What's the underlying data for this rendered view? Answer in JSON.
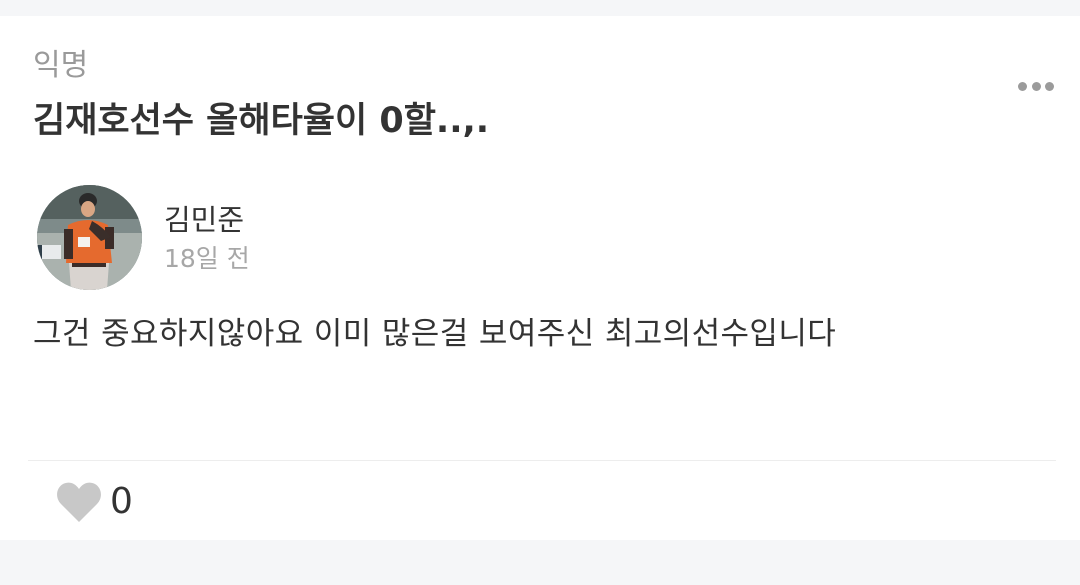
{
  "post": {
    "board": "익명",
    "title": "김재호선수 올해타율이 0할..,.",
    "author": "김민준",
    "time": "18일 전",
    "content": "그건 중요하지않아요 이미 많은걸 보여주신 최고의선수입니다"
  },
  "actions": {
    "like_count": "0",
    "more_icon": "more-horizontal-icon",
    "like_icon": "heart-icon"
  },
  "colors": {
    "background": "#f5f6f8",
    "card": "#ffffff",
    "text": "#333333",
    "muted": "#9a9a9a",
    "heart": "#c8c8c8"
  }
}
